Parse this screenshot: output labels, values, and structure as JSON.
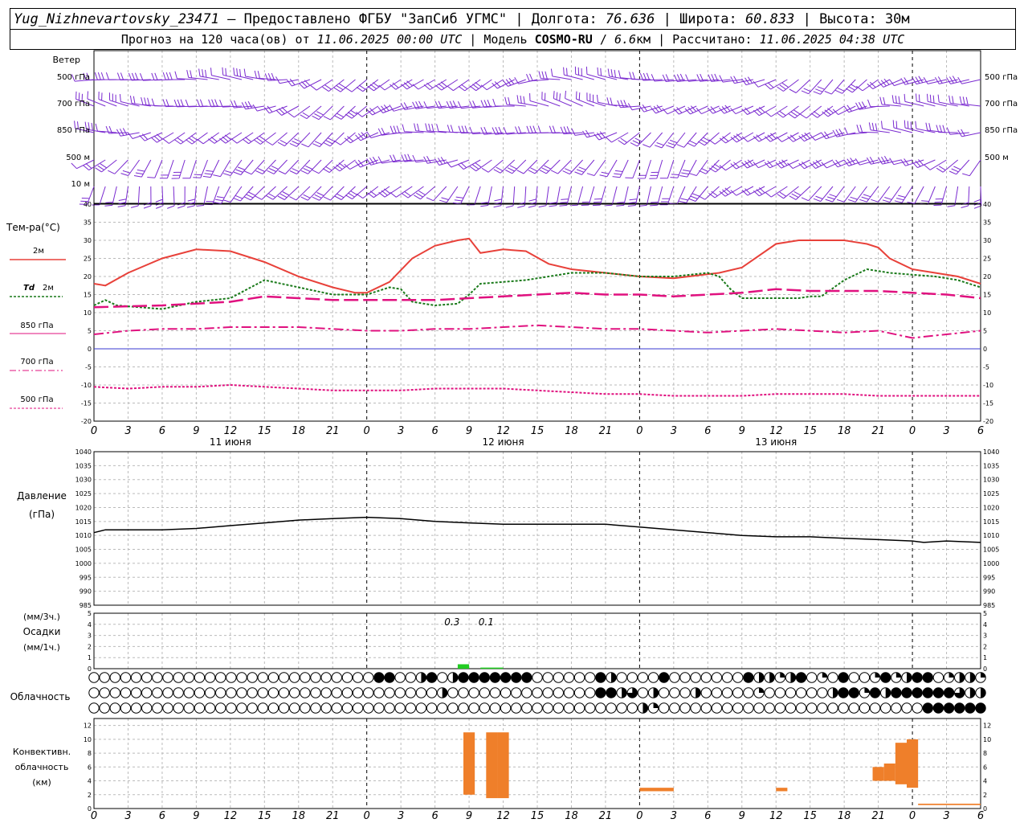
{
  "header": {
    "station": "Yug_Nizhnevartovsky_23471",
    "provider_text": " — Предоставлено ФГБУ \"ЗапСиб УГМС\" | Долгота: ",
    "longitude": "76.636",
    "lat_label": " | Широта: ",
    "latitude": "60.833",
    "alt_label": " | Высота: 30м",
    "forecast_prefix": "Прогноз на 120 часа(ов) от ",
    "forecast_start": "11.06.2025 00:00 UTC",
    "model_label": " | Модель ",
    "model": "COSMO-RU",
    "model_sep": " / ",
    "resolution": "6.6",
    "res_unit": "км | Рассчитано: ",
    "computed": "11.06.2025 04:38 UTC"
  },
  "labels": {
    "wind": "Ветер",
    "wind_levels": [
      "500 гПа",
      "700 гПа",
      "850 гПа",
      "500 м",
      "10  м"
    ],
    "temperature": "Тем-ра(°С)",
    "legend_2m": "2м",
    "legend_td": "Td",
    "legend_td_2m": "2м",
    "legend_850": "850 гПа",
    "legend_700": "700 гПа",
    "legend_500": "500 гПа",
    "pressure": "Давление",
    "pressure_unit": "(гПа)",
    "precip_unit_3h": "(мм/3ч.)",
    "precip": "Осадки",
    "precip_unit_1h": "(мм/1ч.)",
    "cloudiness": "Облачность",
    "conv1": "Конвективн.",
    "conv2": "облачность",
    "conv3": "(км)"
  },
  "colors": {
    "t2m": "#e8413a",
    "td2m": "#1a7a1a",
    "t850": "#e0117f",
    "t700": "#e0117f",
    "t500": "#e0117f",
    "zero_line": "#3a3ad0",
    "pressure": "#000000",
    "precip": "#22cc22",
    "convective": "#ef7f2a",
    "wind": "#7a2ad0"
  },
  "chart_data": [
    {
      "type": "line",
      "name": "temperature",
      "xlim": [
        0,
        78
      ],
      "ylim": [
        -20,
        40
      ],
      "y_ticks": [
        -20,
        -15,
        -10,
        -5,
        0,
        5,
        10,
        15,
        20,
        25,
        30,
        35,
        40
      ],
      "x_tick_labels": [
        "0",
        "3",
        "6",
        "9",
        "12",
        "15",
        "18",
        "21",
        "0",
        "3",
        "6",
        "9",
        "12",
        "15",
        "18",
        "21",
        "0",
        "3",
        "6",
        "9",
        "12",
        "15",
        "18",
        "21",
        "0",
        "3",
        "6"
      ],
      "day_labels": [
        {
          "x": 12,
          "text": "11 июня"
        },
        {
          "x": 36,
          "text": "12 июня"
        },
        {
          "x": 60,
          "text": "13 июня"
        }
      ],
      "series": [
        {
          "name": "2м",
          "x": [
            0,
            1,
            3,
            6,
            9,
            12,
            15,
            18,
            21,
            23,
            24,
            26,
            28,
            30,
            32,
            33,
            34,
            36,
            38,
            40,
            42,
            45,
            48,
            51,
            55,
            57,
            60,
            62,
            64,
            66,
            67,
            68,
            69,
            70,
            72,
            74,
            76,
            78
          ],
          "y": [
            18,
            17.5,
            21,
            25,
            27.5,
            27,
            24,
            20,
            17,
            15.5,
            15.5,
            18.5,
            25,
            28.5,
            30,
            30.5,
            26.5,
            27.5,
            27,
            23.5,
            22,
            21,
            20,
            19.5,
            21,
            22.5,
            29,
            30,
            30,
            30,
            29.5,
            29,
            28,
            25,
            22,
            21,
            20,
            18
          ]
        },
        {
          "name": "Td 2м",
          "x": [
            0,
            1,
            2,
            6,
            9,
            12,
            15,
            18,
            21,
            24,
            26,
            27,
            28,
            30,
            32,
            33,
            34,
            36,
            38,
            40,
            42,
            45,
            48,
            51,
            54,
            55,
            56,
            57,
            58,
            60,
            62,
            63,
            64,
            66,
            68,
            70,
            72,
            74,
            76,
            78
          ],
          "y": [
            12,
            13.5,
            12,
            11,
            13,
            14,
            19,
            17,
            15,
            15,
            17,
            16.5,
            13,
            12,
            12.5,
            15,
            18,
            18.5,
            19,
            20,
            21,
            21,
            20,
            20,
            21,
            20,
            16.5,
            14,
            14,
            14,
            14,
            14.5,
            14.5,
            19,
            22,
            21,
            20.5,
            20,
            19,
            17
          ]
        },
        {
          "name": "850 гПа",
          "x": [
            0,
            6,
            12,
            15,
            18,
            21,
            24,
            27,
            30,
            33,
            36,
            39,
            42,
            45,
            48,
            51,
            54,
            57,
            60,
            63,
            66,
            69,
            72,
            75,
            78
          ],
          "y": [
            11.5,
            12,
            13,
            14.5,
            14,
            13.5,
            13.5,
            13.5,
            13.5,
            14,
            14.5,
            15,
            15.5,
            15,
            15,
            14.5,
            15,
            15.5,
            16.5,
            16,
            16,
            16,
            15.5,
            15,
            14
          ]
        },
        {
          "name": "700 гПа",
          "x": [
            0,
            3,
            6,
            9,
            12,
            15,
            18,
            21,
            24,
            27,
            30,
            33,
            36,
            39,
            42,
            45,
            48,
            51,
            54,
            57,
            60,
            63,
            66,
            69,
            72,
            75,
            78
          ],
          "y": [
            4,
            5,
            5.5,
            5.5,
            6,
            6,
            6,
            5.5,
            5,
            5,
            5.5,
            5.5,
            6,
            6.5,
            6,
            5.5,
            5.5,
            5,
            4.5,
            5,
            5.5,
            5,
            4.5,
            5,
            3,
            4,
            5
          ]
        },
        {
          "name": "500 гПа",
          "x": [
            0,
            3,
            6,
            9,
            12,
            15,
            18,
            21,
            24,
            27,
            30,
            33,
            36,
            39,
            42,
            45,
            48,
            51,
            54,
            57,
            60,
            63,
            66,
            69,
            72,
            75,
            78
          ],
          "y": [
            -10.5,
            -11,
            -10.5,
            -10.5,
            -10,
            -10.5,
            -11,
            -11.5,
            -11.5,
            -11.5,
            -11,
            -11,
            -11,
            -11.5,
            -12,
            -12.5,
            -12.5,
            -13,
            -13,
            -13,
            -12.5,
            -12.5,
            -12.5,
            -13,
            -13,
            -13,
            -13
          ]
        }
      ]
    },
    {
      "type": "line",
      "name": "pressure",
      "ylim": [
        985,
        1040
      ],
      "y_ticks": [
        985,
        990,
        995,
        1000,
        1005,
        1010,
        1015,
        1020,
        1025,
        1030,
        1035,
        1040
      ],
      "x": [
        0,
        1,
        3,
        6,
        9,
        12,
        15,
        18,
        21,
        24,
        27,
        30,
        33,
        36,
        39,
        42,
        45,
        48,
        51,
        54,
        57,
        60,
        63,
        66,
        69,
        72,
        73,
        75,
        78
      ],
      "y": [
        1011,
        1012,
        1012,
        1012,
        1012.5,
        1013.5,
        1014.5,
        1015.5,
        1016,
        1016.5,
        1016,
        1015,
        1014.5,
        1014,
        1014,
        1014,
        1014,
        1013,
        1012,
        1011,
        1010,
        1009.5,
        1009.5,
        1009,
        1008.5,
        1008,
        1007.5,
        1008,
        1007.5
      ]
    },
    {
      "type": "bar",
      "name": "precipitation",
      "ylim": [
        0,
        5
      ],
      "annotations": [
        {
          "x": 31.5,
          "text": "0.3"
        },
        {
          "x": 34.5,
          "text": "0.1"
        }
      ],
      "bars": [
        {
          "x0": 32,
          "x1": 33,
          "value": 0.4
        },
        {
          "x0": 34,
          "x1": 36,
          "value": 0.1
        }
      ]
    },
    {
      "type": "bar",
      "name": "convective",
      "ylim": [
        0,
        13
      ],
      "y_ticks": [
        0,
        2,
        4,
        6,
        8,
        10,
        12
      ],
      "bars": [
        {
          "x0": 32.5,
          "x1": 33.5,
          "bottom": 2,
          "top": 11
        },
        {
          "x0": 34.5,
          "x1": 35.5,
          "bottom": 1.5,
          "top": 11
        },
        {
          "x0": 35.5,
          "x1": 36.5,
          "bottom": 1.5,
          "top": 11
        },
        {
          "x0": 48,
          "x1": 51,
          "bottom": 2.5,
          "top": 3
        },
        {
          "x0": 60,
          "x1": 61,
          "bottom": 2.5,
          "top": 3
        },
        {
          "x0": 68.5,
          "x1": 69.5,
          "bottom": 4,
          "top": 6
        },
        {
          "x0": 69.5,
          "x1": 70.5,
          "bottom": 4,
          "top": 6.5
        },
        {
          "x0": 70.5,
          "x1": 71.5,
          "bottom": 3.5,
          "top": 9.5
        },
        {
          "x0": 71.5,
          "x1": 72.5,
          "bottom": 3,
          "top": 10
        },
        {
          "x0": 72.5,
          "x1": 78,
          "bottom": 0.5,
          "top": 0.7
        }
      ]
    },
    {
      "type": "table",
      "name": "cloud_cover",
      "scale": "0=clear, 1=quarter, 2=half, 3=three-quarter, 4=overcast",
      "rows": [
        "0000000000000000000000000004400240244444440000004200004000000042212401040014124401221",
        "0000000000000000000000000000000002000000000000004423020002000001000000244142444444322",
        "0000000000000000000000000000000000000000000000000000210000000000000000000000000444444"
      ]
    }
  ]
}
